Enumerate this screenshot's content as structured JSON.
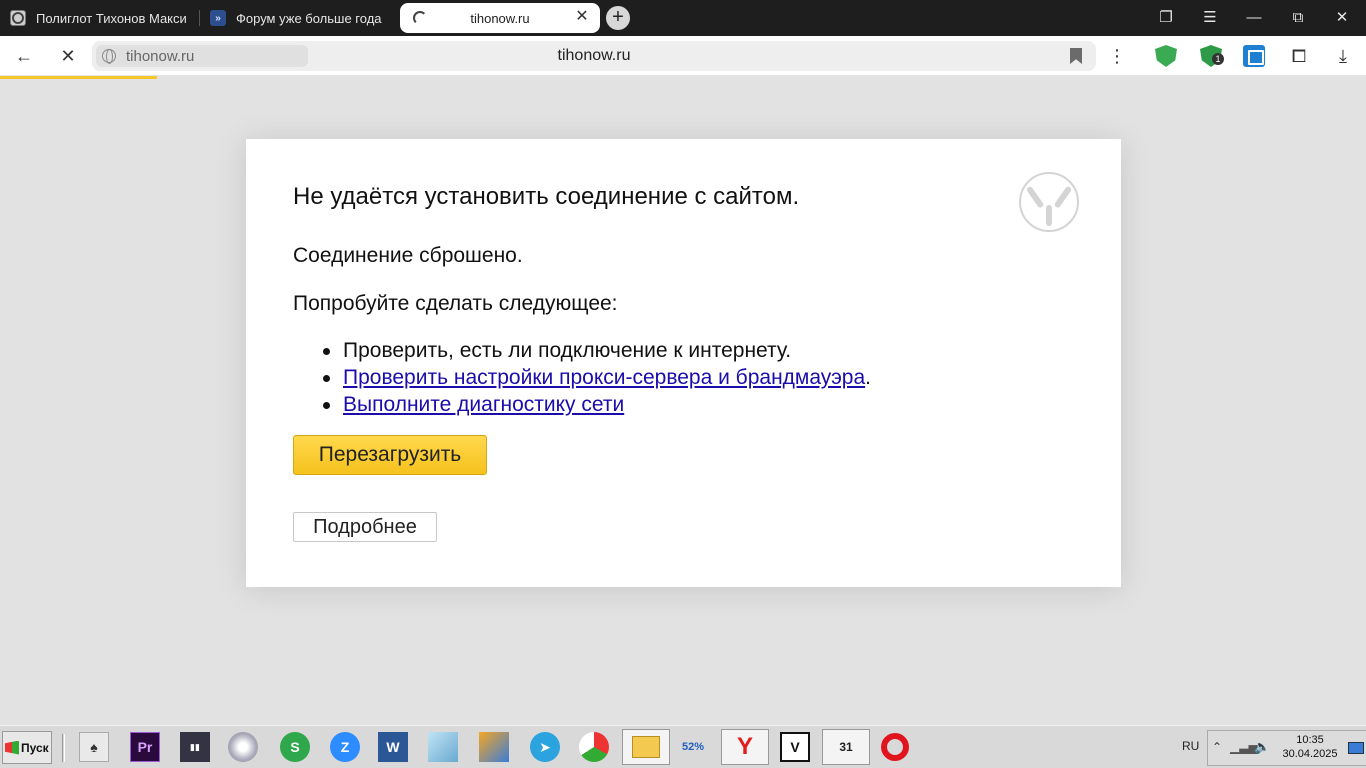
{
  "browser": {
    "tabs": [
      {
        "title": "Полиглот Тихонов Макси"
      },
      {
        "title": "Форум уже больше года"
      },
      {
        "title": "tihonow.ru"
      }
    ],
    "address_chip": "tihonow.ru",
    "address_center": "tihonow.ru",
    "extension_badge": "1",
    "load_progress_percent": 11.5,
    "accent_color": "#f4c62a"
  },
  "error_page": {
    "heading": "Не удаётся установить соединение с сайтом.",
    "reason": "Соединение сброшено.",
    "suggest_intro": "Попробуйте сделать следующее:",
    "suggestion_check": "Проверить, есть ли подключение к интернету.",
    "suggestion_proxy_link": "Проверить настройки прокси-сервера и брандмауэра",
    "suggestion_proxy_period": ".",
    "suggestion_diag_link": "Выполните диагностику сети",
    "reload_button": "Перезагрузить",
    "details_button": "Подробнее",
    "reload_color": "#f5c21d",
    "link_color": "#1a0dab"
  },
  "taskbar": {
    "start_label": "Пуск",
    "language": "RU",
    "time": "10:35",
    "date": "30.04.2025",
    "apps": [
      {
        "name": "solitaire"
      },
      {
        "name": "premiere-pro",
        "label": "Pr"
      },
      {
        "name": "sd-card-tool"
      },
      {
        "name": "cd-burner"
      },
      {
        "name": "green-s-app"
      },
      {
        "name": "zoom"
      },
      {
        "name": "word",
        "label": "W"
      },
      {
        "name": "notepad"
      },
      {
        "name": "image-viewer"
      },
      {
        "name": "telegram"
      },
      {
        "name": "umbrella-app"
      },
      {
        "name": "file-explorer"
      },
      {
        "name": "ccleaner",
        "label": "52%"
      },
      {
        "name": "yandex-browser",
        "label": "Y"
      },
      {
        "name": "v-app",
        "label": "V"
      },
      {
        "name": "calendar-clapper",
        "label": "31"
      },
      {
        "name": "opera"
      }
    ]
  }
}
